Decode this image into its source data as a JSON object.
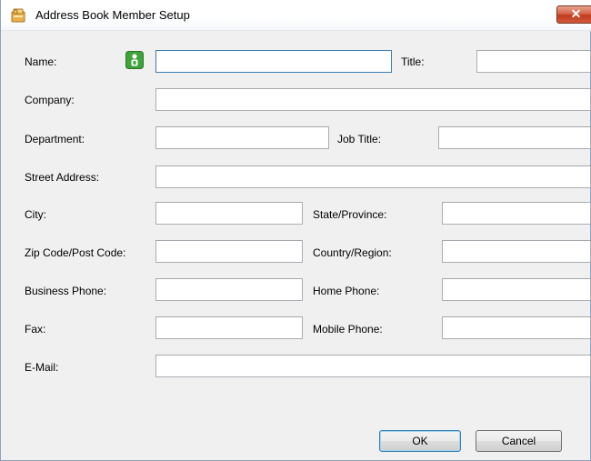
{
  "window": {
    "title": "Address Book Member Setup",
    "icons": {
      "app": "address-book-icon",
      "close": "close-icon",
      "person": "person-icon"
    },
    "accent_close": "#c7432a"
  },
  "form": {
    "name": {
      "label": "Name:",
      "value": ""
    },
    "title": {
      "label": "Title:",
      "value": ""
    },
    "company": {
      "label": "Company:",
      "value": ""
    },
    "department": {
      "label": "Department:",
      "value": ""
    },
    "job_title": {
      "label": "Job Title:",
      "value": ""
    },
    "street_address": {
      "label": "Street Address:",
      "value": ""
    },
    "city": {
      "label": "City:",
      "value": ""
    },
    "state_province": {
      "label": "State/Province:",
      "value": ""
    },
    "zip_code": {
      "label": "Zip Code/Post Code:",
      "value": ""
    },
    "country_region": {
      "label": "Country/Region:",
      "value": ""
    },
    "business_phone": {
      "label": "Business Phone:",
      "value": ""
    },
    "home_phone": {
      "label": "Home Phone:",
      "value": ""
    },
    "fax": {
      "label": "Fax:",
      "value": ""
    },
    "mobile_phone": {
      "label": "Mobile Phone:",
      "value": ""
    },
    "email": {
      "label": "E-Mail:",
      "value": ""
    }
  },
  "buttons": {
    "ok": "OK",
    "cancel": "Cancel"
  }
}
